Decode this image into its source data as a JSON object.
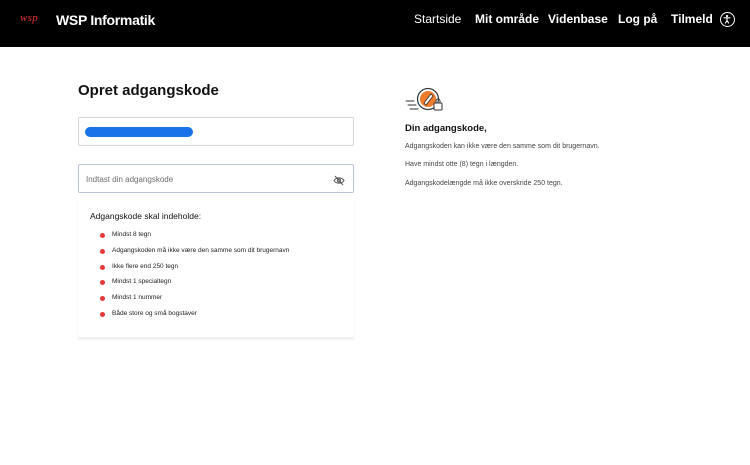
{
  "header": {
    "logo_mark": "wsp",
    "brand": "WSP Informatik",
    "nav": [
      "Startside",
      "Mit område",
      "Videnbase",
      "Log på",
      "Tilmeld"
    ],
    "accessibility_icon": "accessibility-icon"
  },
  "form": {
    "title": "Opret adgangskode",
    "username_value_redacted": true,
    "password": {
      "value": "",
      "placeholder": "Indtast din adgangskode",
      "toggle_icon": "eye-slash-icon"
    }
  },
  "requirements": {
    "title": "Adgangskode skal indeholde:",
    "items": [
      "Mindst 8 tegn",
      "Adgangskoden må ikke være den samme som dit brugernavn",
      "Ikke flere end 250 tegn",
      "Mindst 1 specialtegn",
      "Mindst 1 nummer",
      "Både store og små bogstaver"
    ],
    "bullet_color": "#e53935"
  },
  "info": {
    "icon": "password-lock-icon",
    "heading": "Din adgangskode,",
    "lines": [
      "Adgangskoden kan ikke være den samme som dit brugernavn.",
      "Have mindst otte (8) tegn i længden.",
      "Adgangskodelængde må ikke overskride 250 tegn."
    ]
  },
  "colors": {
    "header_bg": "#000000",
    "accent_orange": "#f07b2a",
    "accent_red": "#e53935",
    "redaction": "#1a73e8"
  }
}
